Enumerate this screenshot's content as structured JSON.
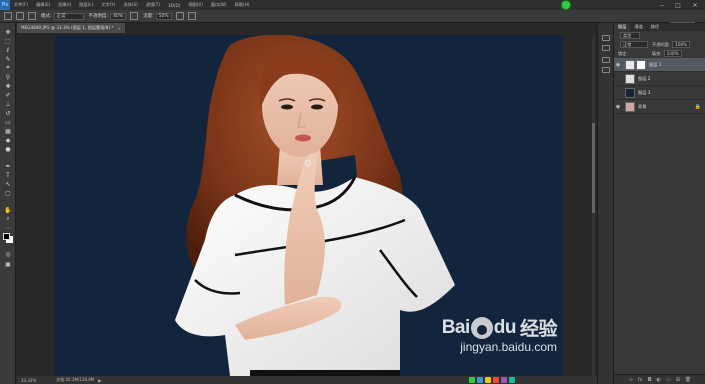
{
  "app": {
    "logo": "Ps"
  },
  "menu": [
    "文件(F)",
    "编辑(E)",
    "图像(I)",
    "图层(L)",
    "文字(Y)",
    "选择(S)",
    "滤镜(T)",
    "3D(D)",
    "视图(V)",
    "窗口(W)",
    "帮助(H)"
  ],
  "window_controls": {
    "minimize": "−",
    "maximize": "□",
    "close": "✕"
  },
  "options": {
    "mode_label": "模式:",
    "mode_value": "正常",
    "opacity_label": "不透明度:",
    "opacity_value": "40%",
    "flow_label": "流量:",
    "flow_value": "50%",
    "workspace": "基本功能"
  },
  "document": {
    "tab_title": "MEG4840.JPG @ 33.3% (图层 1, 图层蒙版/8) *",
    "tab_close": "×",
    "zoom": "33.33%",
    "doc_info": "文档:42.2M/128.8M"
  },
  "layers_panel": {
    "tabs": [
      "图层",
      "通道",
      "路径"
    ],
    "filter_label": "类型",
    "blend_mode": "正常",
    "opacity_label": "不透明度:",
    "opacity_value": "100%",
    "lock_label": "锁定:",
    "fill_label": "填充:",
    "fill_value": "100%",
    "layers": [
      {
        "name": "图层 1",
        "selected": true,
        "visible": true,
        "has_mask": true,
        "thumb_color": "#e9e9e9"
      },
      {
        "name": "图层 2",
        "selected": false,
        "visible": false,
        "has_mask": false,
        "thumb_color": "#dedede"
      },
      {
        "name": "图层 3",
        "selected": false,
        "visible": false,
        "has_mask": false,
        "thumb_color": "#13253c"
      },
      {
        "name": "背景",
        "selected": false,
        "visible": true,
        "has_mask": false,
        "thumb_color": "#c9a9a0",
        "locked": true
      }
    ]
  },
  "watermark": {
    "brand": "Bai",
    "brand_suffix": "du",
    "cn": "经验",
    "url": "jingyan.baidu.com"
  },
  "colors": {
    "canvas_bg": "#13253c",
    "selected_layer": "#545a63",
    "accent": "#2b6cb0"
  }
}
